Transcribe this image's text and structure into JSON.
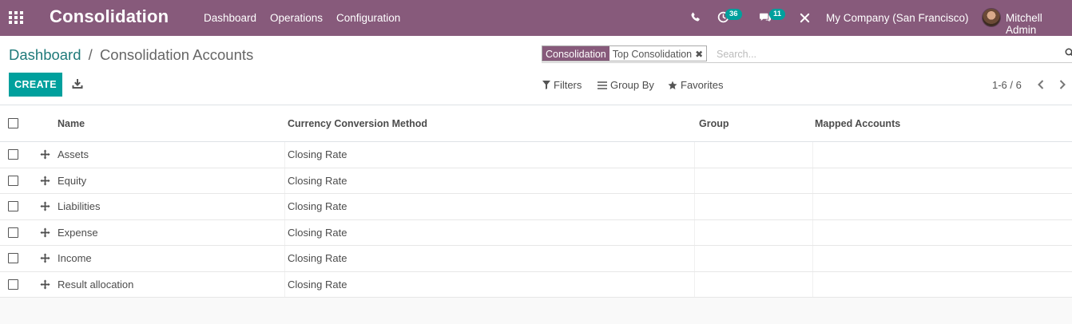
{
  "navbar": {
    "app_title": "Consolidation",
    "menu": [
      "Dashboard",
      "Operations",
      "Configuration"
    ],
    "activity_count": "36",
    "message_count": "11",
    "company": "My Company (San Francisco)",
    "user": "Mitchell Admin"
  },
  "breadcrumb": {
    "parent": "Dashboard",
    "separator": "/",
    "current": "Consolidation Accounts"
  },
  "search": {
    "facet_label": "Consolidation",
    "facet_value": "Top Consolidation",
    "facet_remove": "✖",
    "placeholder": "Search..."
  },
  "toolbar": {
    "create_label": "CREATE",
    "filters_label": "Filters",
    "group_by_label": "Group By",
    "favorites_label": "Favorites"
  },
  "pager": {
    "value": "1-6 / 6"
  },
  "table": {
    "columns": [
      "Name",
      "Currency Conversion Method",
      "Group",
      "Mapped Accounts"
    ],
    "rows": [
      {
        "name": "Assets",
        "method": "Closing Rate",
        "group": "",
        "mapped": ""
      },
      {
        "name": "Equity",
        "method": "Closing Rate",
        "group": "",
        "mapped": ""
      },
      {
        "name": "Liabilities",
        "method": "Closing Rate",
        "group": "",
        "mapped": ""
      },
      {
        "name": "Expense",
        "method": "Closing Rate",
        "group": "",
        "mapped": ""
      },
      {
        "name": "Income",
        "method": "Closing Rate",
        "group": "",
        "mapped": ""
      },
      {
        "name": "Result allocation",
        "method": "Closing Rate",
        "group": "",
        "mapped": ""
      }
    ]
  },
  "colors": {
    "navbar": "#875a7b",
    "primary": "#00a09d",
    "link": "#1f7a7a"
  }
}
